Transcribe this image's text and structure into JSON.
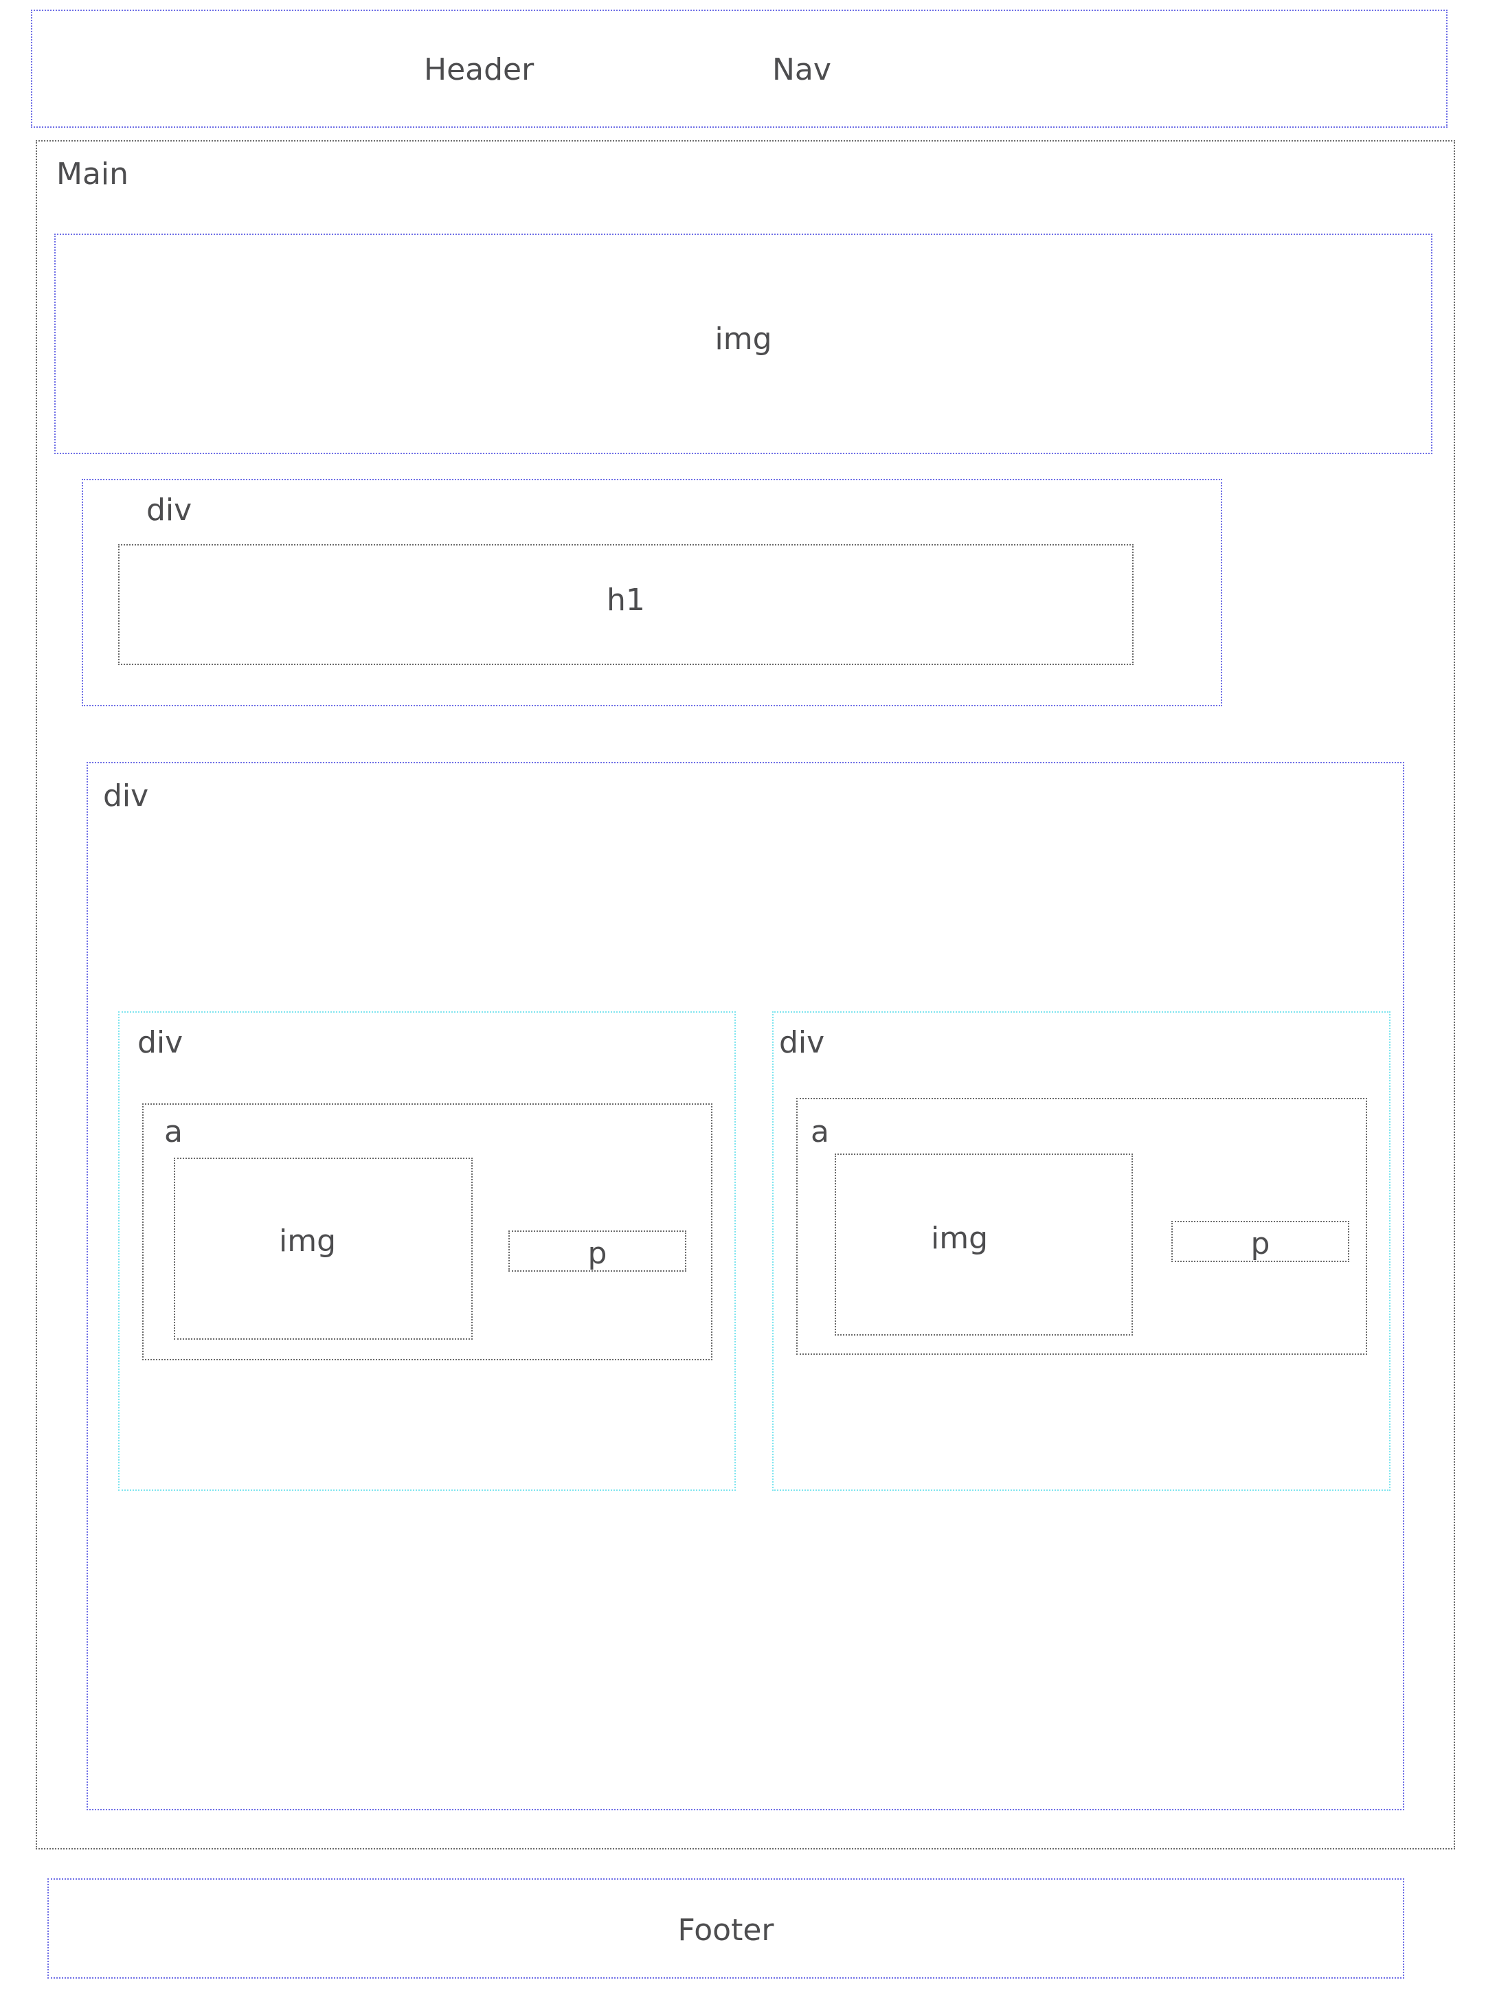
{
  "header": {
    "header_label": "Header",
    "nav_label": "Nav"
  },
  "main": {
    "label": "Main",
    "hero_img_label": "img",
    "title_block": {
      "div_label": "div",
      "h1_label": "h1"
    },
    "content_block": {
      "div_label": "div",
      "cards": [
        {
          "div_label": "div",
          "a_label": "a",
          "img_label": "img",
          "p_label": "p"
        },
        {
          "div_label": "div",
          "a_label": "a",
          "img_label": "img",
          "p_label": "p"
        }
      ]
    }
  },
  "footer": {
    "label": "Footer"
  },
  "colors": {
    "semantic_section": "#6f6fe6",
    "generic_element": "#6b6b6b",
    "card_container": "#7fe5ef",
    "text": "#4d4d4f"
  }
}
